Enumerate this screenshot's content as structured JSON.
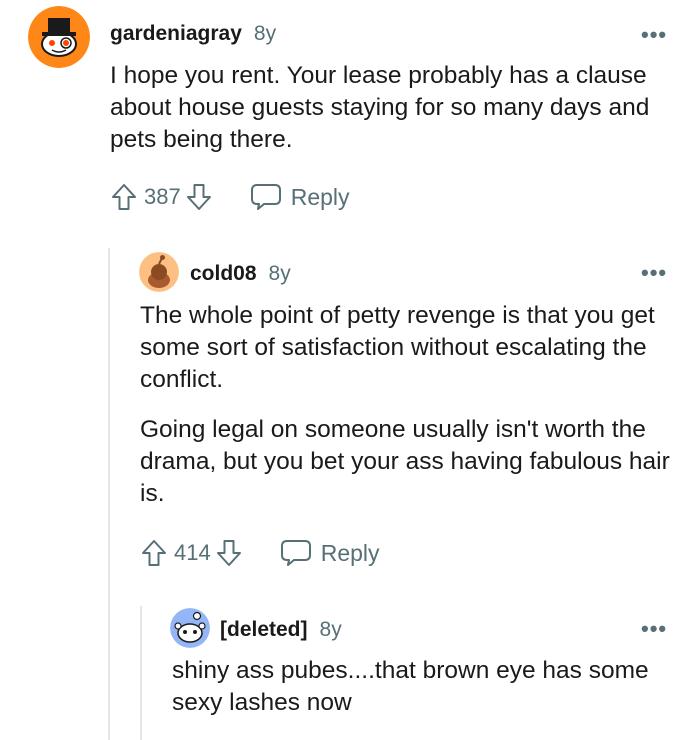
{
  "comments": [
    {
      "username": "gardeniagray",
      "age": "8y",
      "paragraphs": [
        "I hope you rent. Your lease probably has a clause about house guests staying for so many days and pets being there."
      ],
      "score": "387",
      "reply_label": "Reply",
      "avatar_icon": "snoo-tophat-avatar-icon"
    },
    {
      "username": "cold08",
      "age": "8y",
      "paragraphs": [
        "The whole point of petty revenge is that you get some sort of satisfaction without escalating the conflict.",
        "Going legal on someone usually isn't worth the drama, but you bet your ass having fabulous hair is."
      ],
      "score": "414",
      "reply_label": "Reply",
      "avatar_icon": "snoo-default-avatar-icon"
    },
    {
      "username": "[deleted]",
      "age": "8y",
      "paragraphs": [
        "shiny ass pubes....that brown eye has some sexy lashes now"
      ],
      "avatar_icon": "snoo-deleted-avatar-icon"
    }
  ],
  "more_options": "•••",
  "colors": {
    "accent_orange": "#ff4500",
    "meta_gray": "#576f76",
    "thread_line": "#e4e6e8"
  }
}
